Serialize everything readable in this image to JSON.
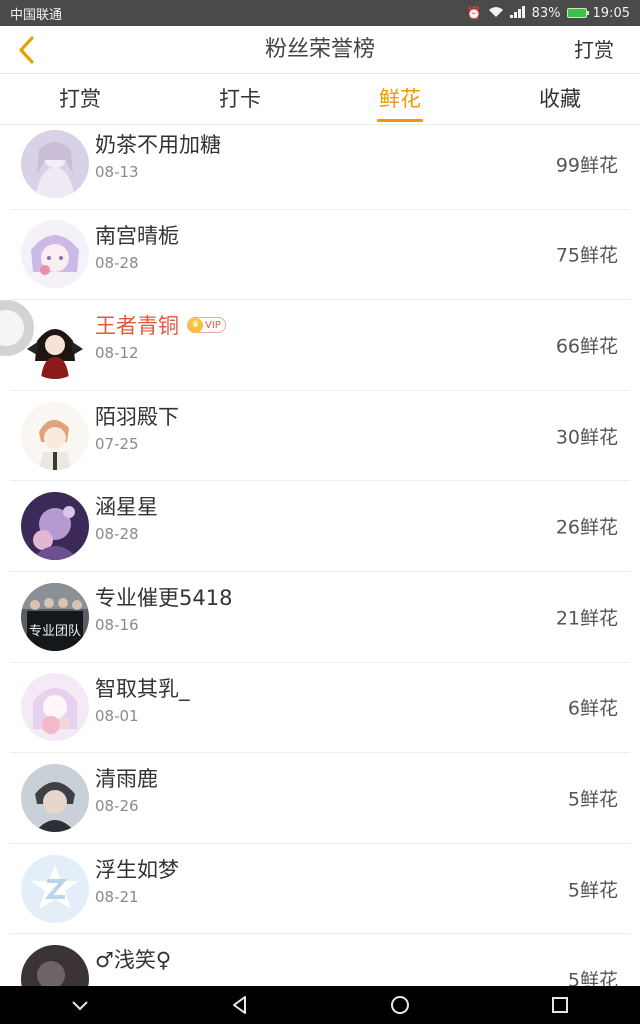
{
  "status_bar": {
    "carrier": "中国联通",
    "battery_percent": "83%",
    "time": "19:05"
  },
  "nav": {
    "title": "粉丝荣誉榜",
    "action_label": "打赏"
  },
  "tabs": [
    {
      "label": "打赏",
      "active": false
    },
    {
      "label": "打卡",
      "active": false
    },
    {
      "label": "鲜花",
      "active": true
    },
    {
      "label": "收藏",
      "active": false
    }
  ],
  "vip_badge": "VIP",
  "fans": [
    {
      "name": "奶茶不用加糖",
      "date": "08-13",
      "count": "99鲜花"
    },
    {
      "name": "南宫晴栀",
      "date": "08-28",
      "count": "75鲜花"
    },
    {
      "name": "王者青铜",
      "date": "08-12",
      "count": "66鲜花",
      "vip": true
    },
    {
      "name": "陌羽殿下",
      "date": "07-25",
      "count": "30鲜花"
    },
    {
      "name": "涵星星",
      "date": "08-28",
      "count": "26鲜花"
    },
    {
      "name": "专业催更5418",
      "date": "08-16",
      "count": "21鲜花",
      "avatar_text": "专业团队"
    },
    {
      "name": "智取其乳_",
      "date": "08-01",
      "count": "6鲜花"
    },
    {
      "name": "清雨鹿",
      "date": "08-26",
      "count": "5鲜花"
    },
    {
      "name": "浮生如梦",
      "date": "08-21",
      "count": "5鲜花"
    },
    {
      "name": "♂浅笑♀",
      "date": "",
      "count": "5鲜花"
    }
  ],
  "colors": {
    "accent": "#f39800",
    "vip_name": "#e05a3a"
  }
}
